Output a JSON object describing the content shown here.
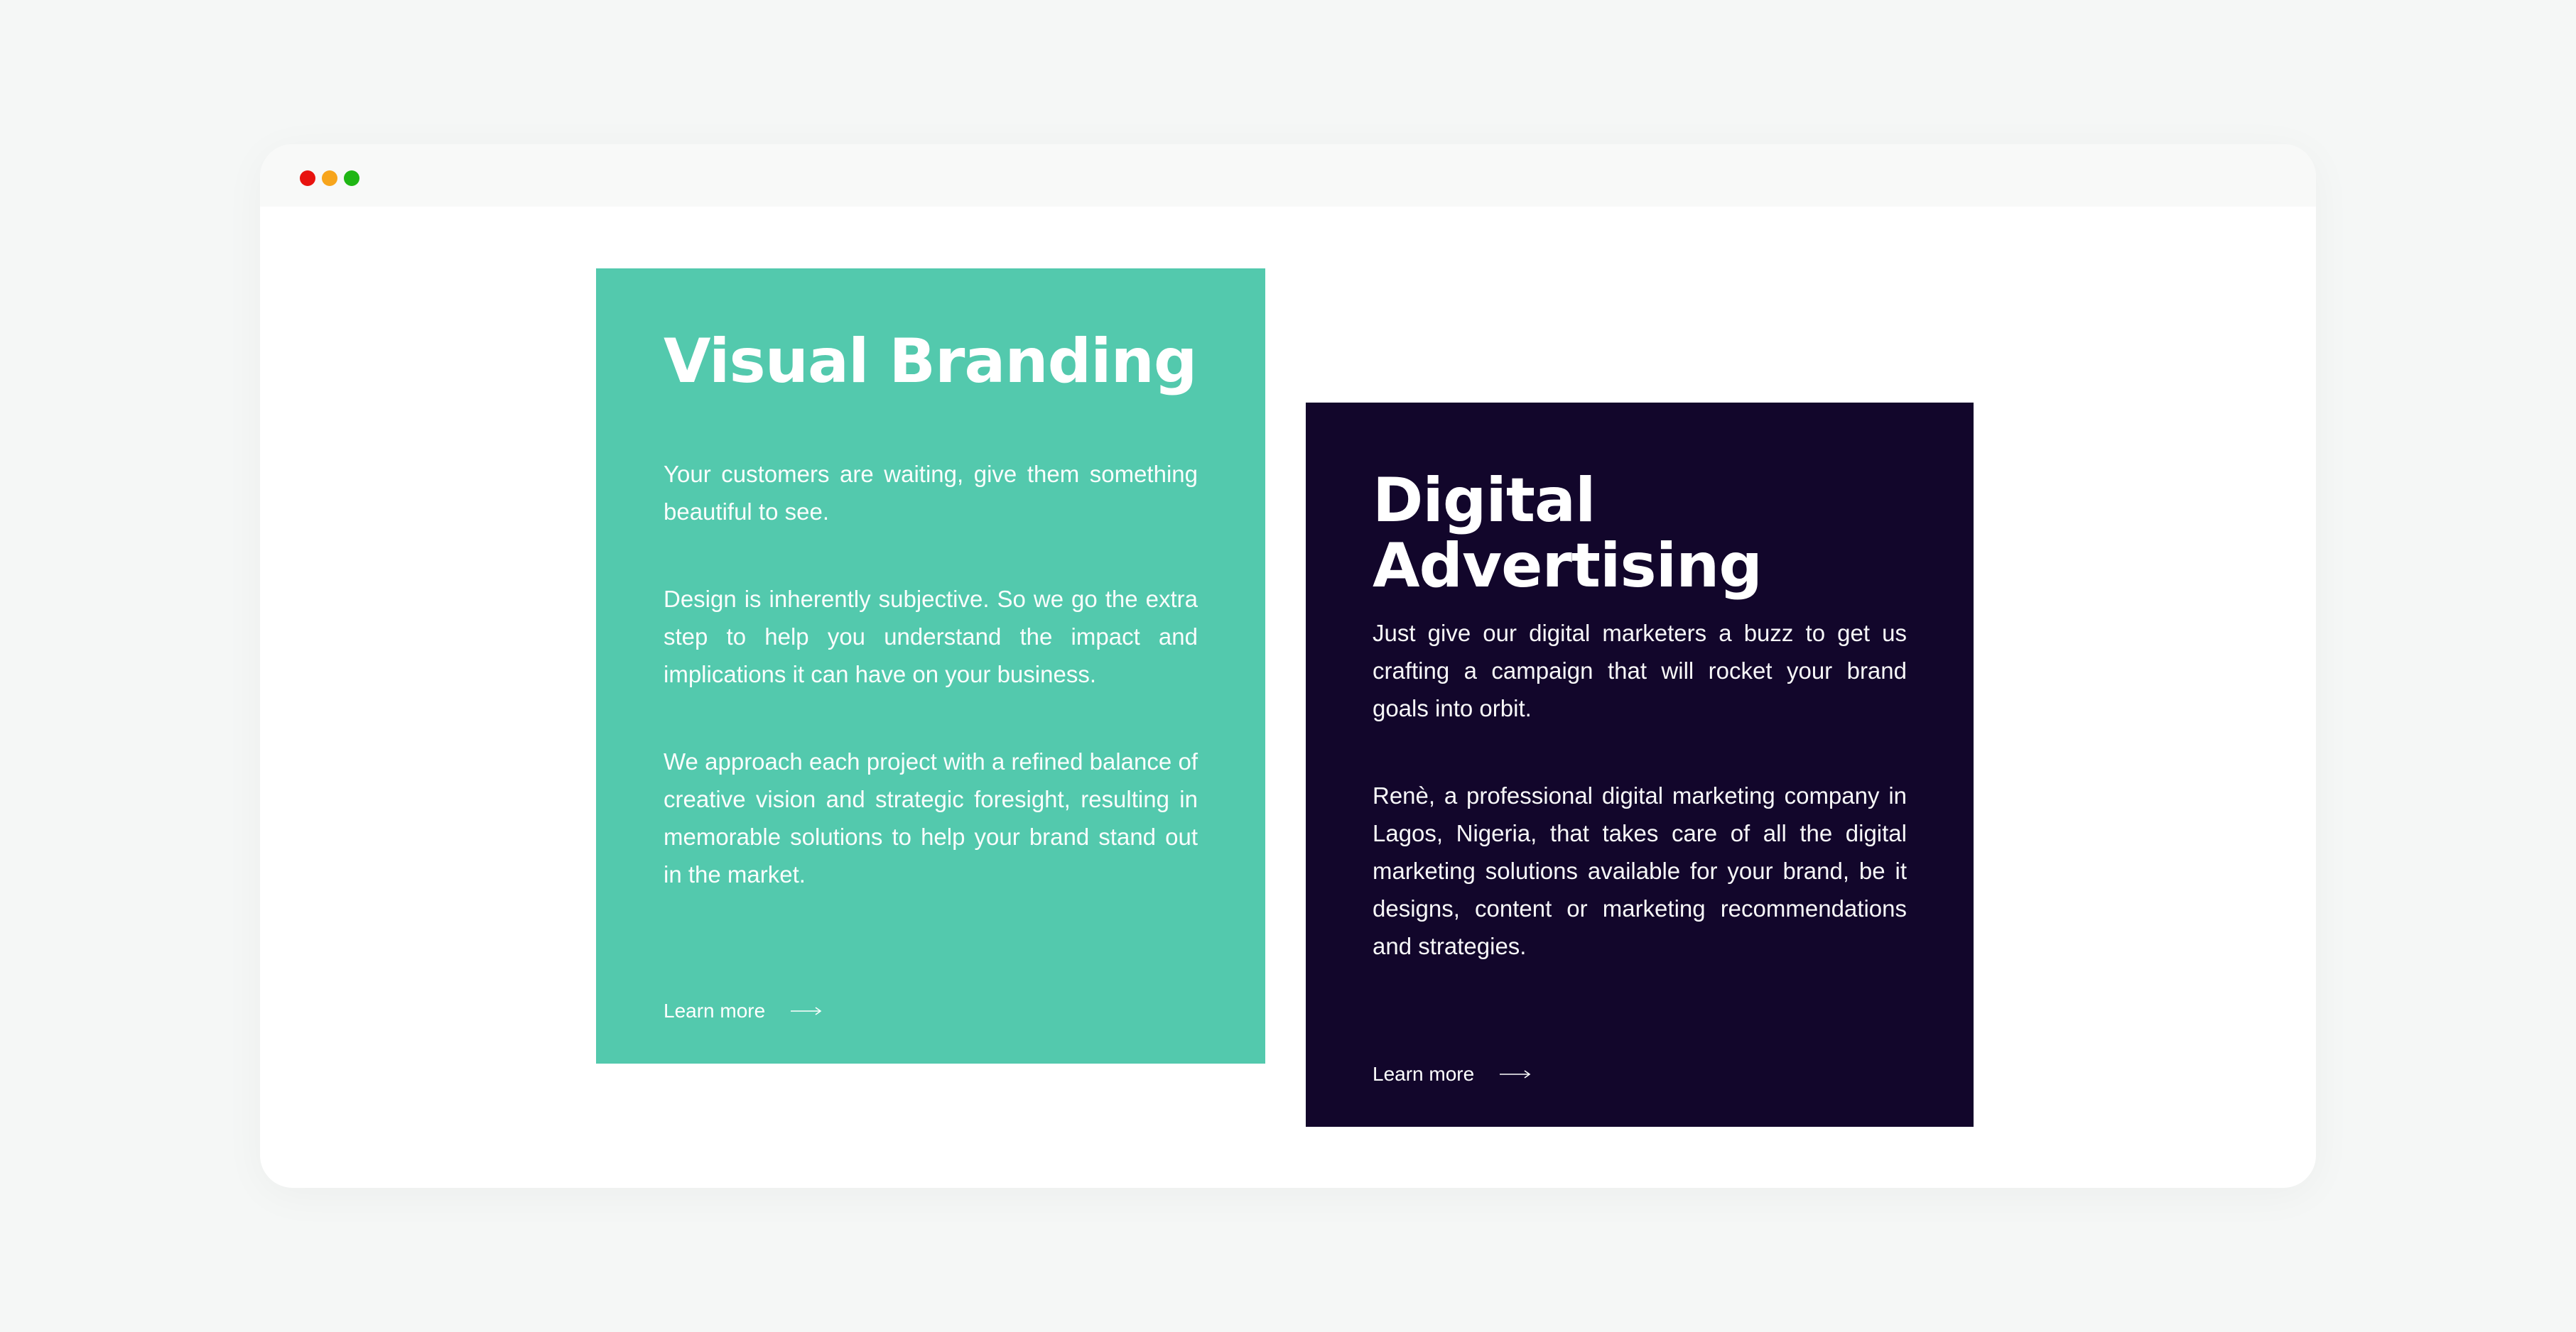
{
  "window": {
    "dots": [
      {
        "name": "close",
        "color": "#e8130f"
      },
      {
        "name": "minimize",
        "color": "#f7a51c"
      },
      {
        "name": "maximize",
        "color": "#1fb614"
      }
    ]
  },
  "colors": {
    "branding_bg": "#53c9ad",
    "advertising_bg": "#12062b",
    "text": "#ffffff"
  },
  "cards": [
    {
      "title": "Visual Branding",
      "paragraphs": [
        "Your customers are waiting, give them something beautiful to see.",
        "Design is inherently subjective. So we go the extra step to help you understand the impact and implications it can have on your business.",
        "We approach each project with a refined balance of creative vision and strategic foresight, resulting in memorable solutions to help your brand stand out in the market."
      ],
      "cta": {
        "label": "Learn more",
        "icon": "arrow-right-icon"
      }
    },
    {
      "title": "Digital Advertising",
      "paragraphs": [
        "Just give our digital marketers a buzz to get us crafting a campaign that will rocket your brand goals into orbit.",
        "Renè, a professional digital marketing company in Lagos, Nigeria, that takes care of all the digital marketing solutions available for your brand, be it designs, content or marketing recommendations and strategies."
      ],
      "cta": {
        "label": "Learn more",
        "icon": "arrow-right-icon"
      }
    }
  ]
}
